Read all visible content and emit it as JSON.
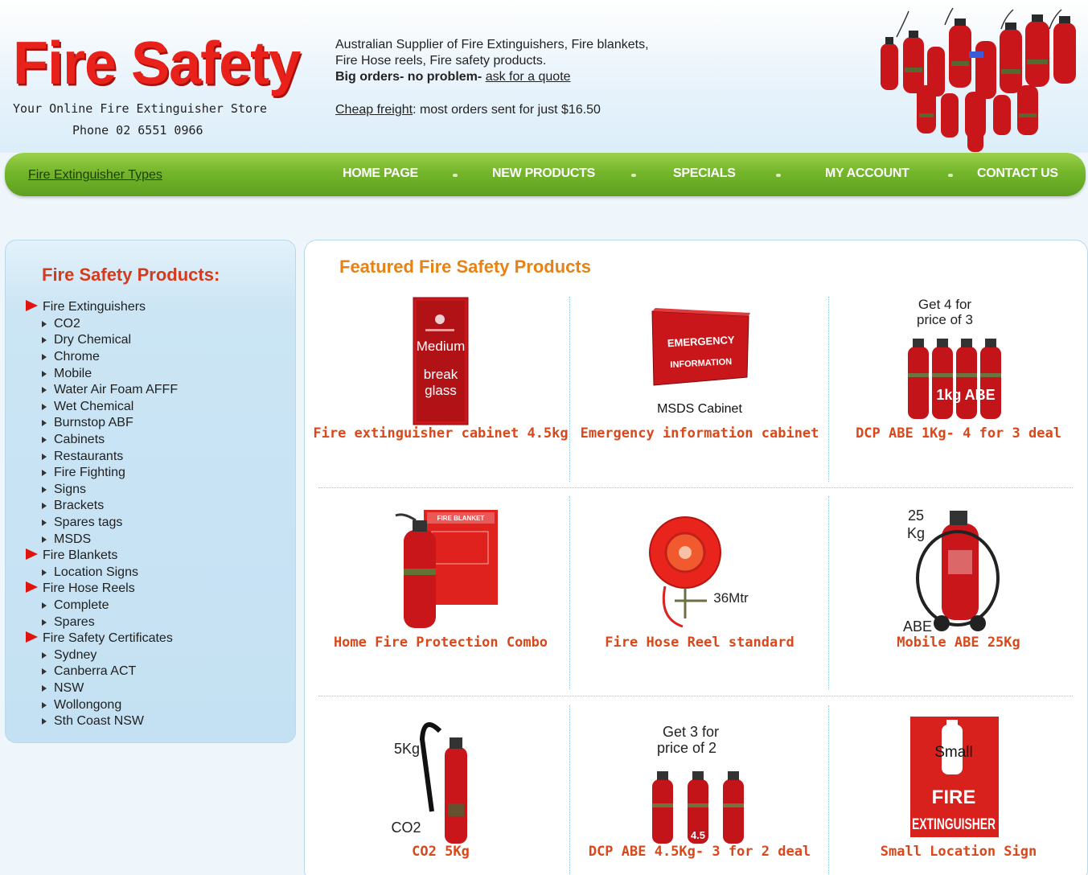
{
  "header": {
    "logo_title": "Fire Safety",
    "logo_tagline": "Your Online Fire Extinguisher Store",
    "logo_phone": "Phone 02 6551 0966",
    "info_line1": "Australian Supplier of Fire Extinguishers, Fire blankets,",
    "info_line2": "Fire Hose reels, Fire safety products.",
    "big_orders": "Big orders- no problem-",
    "quote_link": "ask for a quote",
    "freight_link": "Cheap freight",
    "freight_text": ": most orders sent for just $16.50"
  },
  "nav": {
    "side_link": "Fire Extinguisher Types",
    "items": [
      "HOME PAGE",
      "NEW PRODUCTS",
      "SPECIALS",
      "MY ACCOUNT",
      "CONTACT US"
    ]
  },
  "sidebar": {
    "title": "Fire Safety Products:",
    "categories": [
      {
        "label": "Fire Extinguishers",
        "level": 0
      },
      {
        "label": "CO2",
        "level": 1
      },
      {
        "label": "Dry Chemical",
        "level": 1
      },
      {
        "label": "Chrome",
        "level": 1
      },
      {
        "label": "Mobile",
        "level": 1
      },
      {
        "label": "Water Air Foam AFFF",
        "level": 1
      },
      {
        "label": "Wet Chemical",
        "level": 1
      },
      {
        "label": "Burnstop ABF",
        "level": 1
      },
      {
        "label": "Cabinets",
        "level": 1
      },
      {
        "label": "Restaurants",
        "level": 1
      },
      {
        "label": "Fire Fighting",
        "level": 1
      },
      {
        "label": "Signs",
        "level": 1
      },
      {
        "label": "Brackets",
        "level": 1
      },
      {
        "label": "Spares tags",
        "level": 1
      },
      {
        "label": "MSDS",
        "level": 1
      },
      {
        "label": "Fire Blankets",
        "level": 0
      },
      {
        "label": "Location Signs",
        "level": 1
      },
      {
        "label": "Fire Hose Reels",
        "level": 0
      },
      {
        "label": "Complete",
        "level": 1
      },
      {
        "label": "Spares",
        "level": 1
      },
      {
        "label": "Fire Safety Certificates",
        "level": 0
      },
      {
        "label": "Sydney",
        "level": 1
      },
      {
        "label": "Canberra ACT",
        "level": 1
      },
      {
        "label": "NSW",
        "level": 1
      },
      {
        "label": "Wollongong",
        "level": 1
      },
      {
        "label": "Sth Coast NSW",
        "level": 1
      }
    ]
  },
  "main": {
    "title": "Featured Fire Safety Products",
    "products": [
      {
        "name": "Fire extinguisher cabinet 4.5kg",
        "image_text": [
          "Medium",
          "break",
          "glass"
        ]
      },
      {
        "name": "Emergency information cabinet",
        "image_text": [
          "EMERGENCY",
          "INFORMATION",
          "MSDS Cabinet"
        ]
      },
      {
        "name": "DCP ABE 1Kg- 4 for 3 deal",
        "image_text": [
          "Get 4 for",
          "price of 3",
          "1kg ABE"
        ]
      },
      {
        "name": "Home Fire Protection Combo",
        "image_text": [
          "FIRE BLANKET"
        ]
      },
      {
        "name": "Fire Hose Reel standard",
        "image_text": [
          "36Mtr"
        ]
      },
      {
        "name": "Mobile ABE 25Kg",
        "image_text": [
          "25",
          "Kg",
          "ABE"
        ]
      },
      {
        "name": "CO2 5Kg",
        "image_text": [
          "5Kg",
          "CO2"
        ]
      },
      {
        "name": "DCP ABE 4.5Kg- 3 for 2 deal",
        "image_text": [
          "Get 3 for",
          "price of 2",
          "4.5"
        ]
      },
      {
        "name": "Small Location Sign",
        "image_text": [
          "Small",
          "FIRE",
          "EXTINGUISHER"
        ]
      }
    ]
  },
  "colors": {
    "brand_red": "#e8221a",
    "nav_green": "#74b62b",
    "featured_orange": "#e78214",
    "product_name": "#d9481a",
    "sidebar_title": "#d63a1c"
  }
}
